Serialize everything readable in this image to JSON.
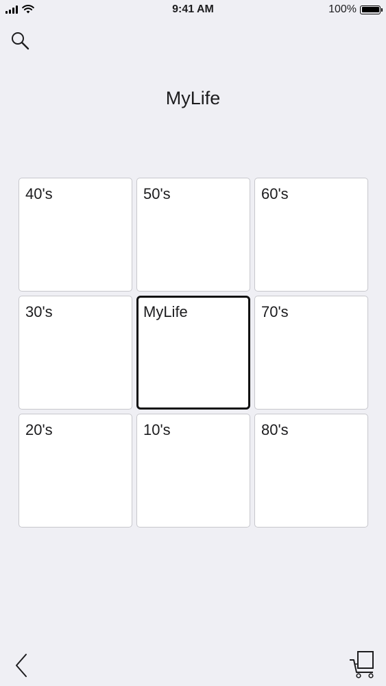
{
  "status_bar": {
    "time": "9:41 AM",
    "battery": "100%",
    "battery_level": 1.0,
    "icons": [
      "signal-icon",
      "wifi-icon",
      "battery-icon"
    ]
  },
  "header": {
    "title": "MyLife",
    "search_icon": "search-icon"
  },
  "grid": {
    "cells": [
      {
        "label": "40's",
        "selected": false
      },
      {
        "label": "50's",
        "selected": false
      },
      {
        "label": "60's",
        "selected": false
      },
      {
        "label": "30's",
        "selected": false
      },
      {
        "label": "MyLife",
        "selected": true
      },
      {
        "label": "70's",
        "selected": false
      },
      {
        "label": "20's",
        "selected": false
      },
      {
        "label": "10's",
        "selected": false
      },
      {
        "label": "80's",
        "selected": false
      }
    ]
  },
  "footer": {
    "back_icon": "chevron-left-icon",
    "cart_icon": "cart-icon"
  }
}
